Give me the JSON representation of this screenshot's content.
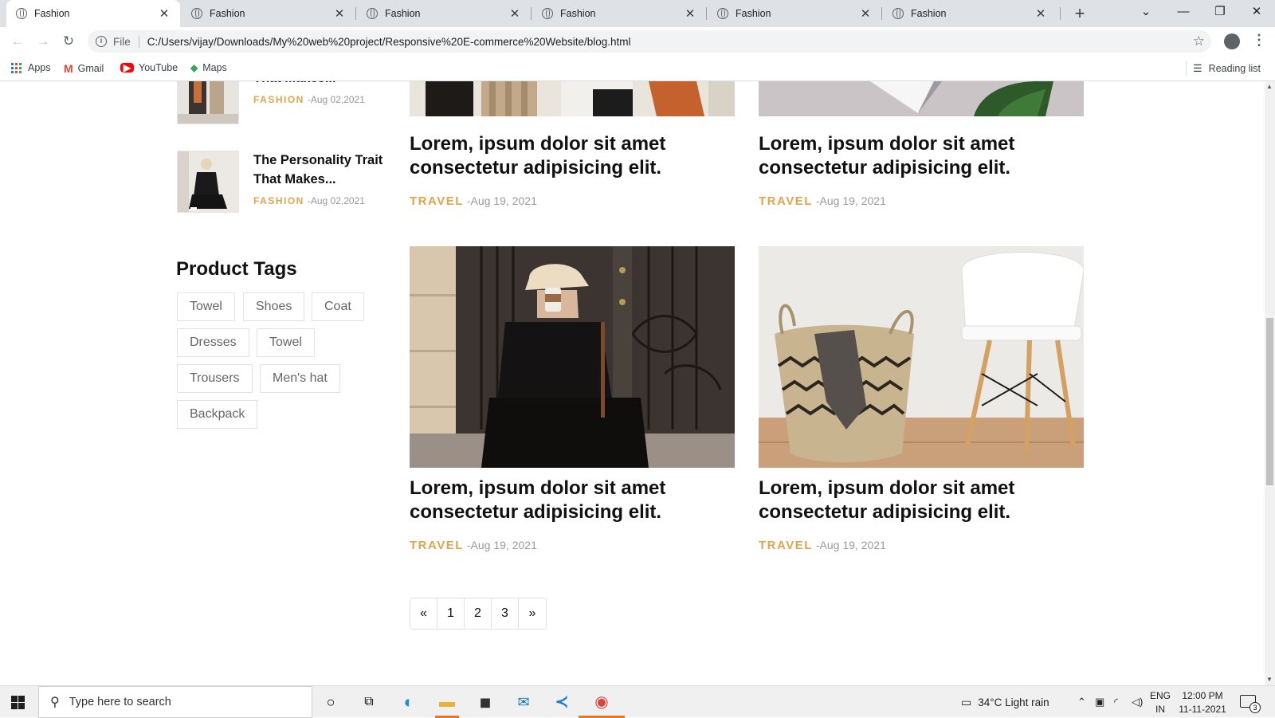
{
  "browser": {
    "tabs": [
      {
        "title": "Fashion",
        "active": true
      },
      {
        "title": "Fashion",
        "active": false
      },
      {
        "title": "Fashion",
        "active": false
      },
      {
        "title": "Fashion",
        "active": false
      },
      {
        "title": "Fashion",
        "active": false
      },
      {
        "title": "Fashion",
        "active": false
      }
    ],
    "tab_close": "✕",
    "new_tab": "+",
    "address": {
      "scheme": "File",
      "url": "C:/Users/vijay/Downloads/My%20web%20project/Responsive%20E-commerce%20Website/blog.html"
    },
    "bookmarks": [
      {
        "label": "Apps",
        "icon": "apps-grid-icon"
      },
      {
        "label": "Gmail",
        "icon": "gmail-icon"
      },
      {
        "label": "YouTube",
        "icon": "youtube-icon"
      },
      {
        "label": "Maps",
        "icon": "maps-icon"
      }
    ],
    "reading_list": "Reading list"
  },
  "sidebar": {
    "recent_posts": [
      {
        "title": "That Makes...",
        "category": "FASHION",
        "date": "-Aug 02,2021"
      },
      {
        "title": "The Personality Trait That Makes...",
        "category": "FASHION",
        "date": "-Aug 02,2021"
      }
    ],
    "tags_title": "Product Tags",
    "tags": [
      "Towel",
      "Shoes",
      "Coat",
      "Dresses",
      "Towel",
      "Trousers",
      "Men's hat",
      "Backpack"
    ]
  },
  "blog": {
    "posts": [
      {
        "title": "Lorem, ipsum dolor sit amet consectetur adipisicing elit.",
        "category": "TRAVEL",
        "date": "-Aug 19, 2021"
      },
      {
        "title": "Lorem, ipsum dolor sit amet consectetur adipisicing elit.",
        "category": "TRAVEL",
        "date": "-Aug 19, 2021"
      },
      {
        "title": "Lorem, ipsum dolor sit amet consectetur adipisicing elit.",
        "category": "TRAVEL",
        "date": "-Aug 19, 2021"
      },
      {
        "title": "Lorem, ipsum dolor sit amet consectetur adipisicing elit.",
        "category": "TRAVEL",
        "date": "-Aug 19, 2021"
      }
    ],
    "pagination": [
      "«",
      "1",
      "2",
      "3",
      "»"
    ]
  },
  "taskbar": {
    "search_placeholder": "Type here to search",
    "weather": "34°C  Light rain",
    "lang_line1": "ENG",
    "lang_line2": "IN",
    "time": "12:00 PM",
    "date": "11-11-2021",
    "notification_count": "3"
  },
  "colors": {
    "accent_category": "#e2a449",
    "tab_strip": "#dee1e6",
    "taskbar": "#f0f0f0"
  }
}
